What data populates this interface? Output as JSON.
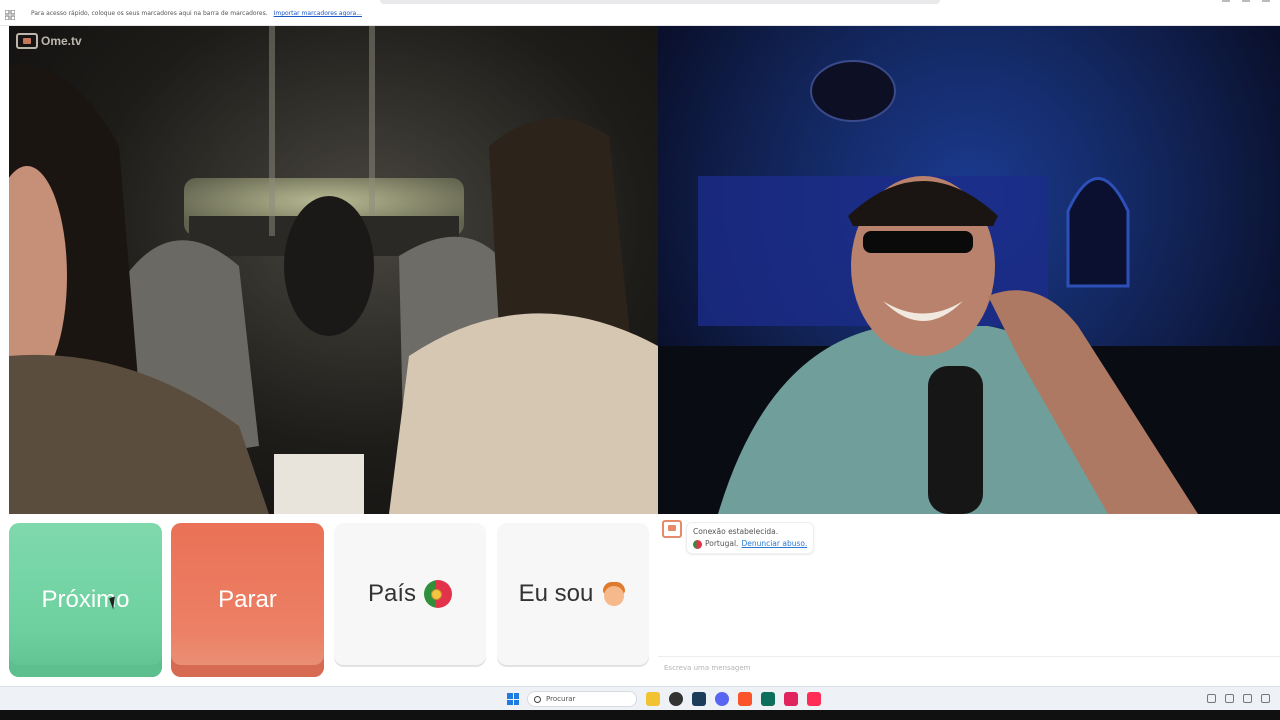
{
  "bookmarks_bar": {
    "hint": "Para acesso rápido, coloque os seus marcadores aqui na barra de marcadores.",
    "import_link": "Importar marcadores agora..."
  },
  "logo": {
    "text": "Ome.tv"
  },
  "controls": {
    "next_label": "Próximo",
    "stop_label": "Parar",
    "country_label": "País",
    "country_icon": "portugal-flag-icon",
    "iam_label": "Eu sou",
    "iam_icon": "boy-emoji-icon"
  },
  "chat": {
    "message_line1": "Conexão estabelecida.",
    "country": "Portugal.",
    "report_link": "Denunciar abuso.",
    "input_placeholder": "Escreva uma mensagem"
  },
  "taskbar": {
    "search_placeholder": "Procurar"
  },
  "colors": {
    "next": "#6dd09f",
    "stop": "#ec7a5f",
    "neutral_button": "#f7f7f7",
    "link": "#2b7bd6"
  }
}
